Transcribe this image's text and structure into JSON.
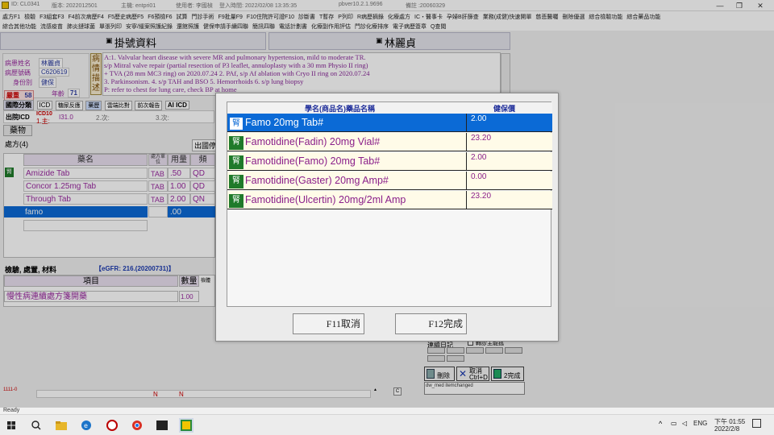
{
  "titlebar": {
    "id": "ID: CL0341",
    "ver": "版本: 2022012501",
    "host": "主機: entpri01",
    "user": "使用者: 李國楨",
    "login": "登入時間: 2022/02/08 13:35:35",
    "server": "pbver10.2.1.9696",
    "note": "備註 :20060329",
    "min": "—",
    "max": "❐",
    "close": "✕"
  },
  "menu1": [
    "處方F1",
    "檢驗",
    "F3組套F3",
    "F4前次病歷F4",
    "F5歷史病歷F5",
    "F6預檢F6",
    "試算",
    "門診手術",
    "F9批量F9",
    "F10住院許可證F10",
    "診斷書",
    "T暫存",
    "P列印",
    "R病歷摘錄",
    "化療處方",
    "IC・醫事卡",
    "孕婦B肝篩查",
    "業務(成健)快速開單",
    "慈悲醫囑",
    "刪除優選",
    "綜合檢驗功能",
    "綜合藥品功能"
  ],
  "menu2": [
    "綜合其他功能",
    "流感疫苗",
    "肺炎鏈球菌",
    "單張列印",
    "安寧/緩案照護紀錄",
    "還館照護",
    "健保申請手續四聯",
    "簡訊四聯",
    "電話計劃書",
    "化療副作用評估",
    "門診化療排序",
    "電子病歷簽章",
    "Q查閱"
  ],
  "header": {
    "reg_title": "掛號資料",
    "patient_name": "林麗貞"
  },
  "patient": {
    "name_label": "病患姓名",
    "name": "林麗貞",
    "chart_label": "病歷號碼",
    "chart": "C620619",
    "id_label": "身份別",
    "id": "健保",
    "severe": "嚴重",
    "severe_val": "58",
    "age_label": "年齡",
    "age": "71"
  },
  "desc": {
    "button": "病情描述",
    "lines": [
      "A:1. Valvular heart disease with severe MR and pulmonary hypertension, mild to moderate TR.",
      "s/p Mitral valve repair (partial resection of P3 leaflet, annuloplasty with a 30 mm Physio II ring)",
      "+ TVA (28 mm MC3 ring) on 2020.07.24  2. PAf, s/p Af ablation with Cryo II ring on 2020.07.24",
      "3. Parkinsonism.  4. s/p TAH and BSO   5. Hemorrhoids  6. s/p lung biopsy",
      "P: refer to chest for lung care, check BP at home"
    ]
  },
  "classrow": [
    "國際分類",
    "ICD",
    "糖尿反應",
    "藥歷",
    "雲端比對",
    "前次報告",
    "AI ICD"
  ],
  "icd": {
    "out_label": "出院ICD",
    "icd10": "ICD10",
    "main": "1.主:",
    "main_code": "I31.0",
    "second": "2.次:",
    "third": "3.次:"
  },
  "tab_drug": "藥物",
  "rx": {
    "title": "處方(4)",
    "right_label": "出國停",
    "headers": [
      "藥名",
      "處方單位",
      "用量",
      "頻"
    ],
    "rows": [
      {
        "icon": "腎",
        "name": "Amizide Tab",
        "unit": "TAB",
        "qty": ".50",
        "freq": "QD"
      },
      {
        "icon": "",
        "name": "Concor 1.25mg Tab",
        "unit": "TAB",
        "qty": "1.00",
        "freq": "QD"
      },
      {
        "icon": "",
        "name": "Through Tab",
        "unit": "TAB",
        "qty": "2.00",
        "freq": "QN"
      },
      {
        "icon": "",
        "name": "famo",
        "unit": "",
        "qty": ".00",
        "freq": ""
      }
    ]
  },
  "exam": {
    "title": "檢驗, 處置, 材料",
    "egfr": "【eGFR: 216.(20200731)】",
    "head_item": "項目",
    "head_qty": "數量",
    "head_extra": "檢體",
    "row_item": "慢性病連續處方箋開藥",
    "row_qty": "1.00"
  },
  "rightpanel": {
    "label": "連續日記",
    "check_label": "轉診主能孤",
    "delete": "刪除",
    "cancel": "取消 Ctrl+D",
    "done": "2完成",
    "dw": "dw_med  itemchanged"
  },
  "bottom": {
    "left_code": "1111-0",
    "n1": "N",
    "n2": "N",
    "arrow": "▲",
    "c": "C"
  },
  "status": "Ready",
  "modal": {
    "head_name": "學名(商品名)藥品名稱",
    "head_price": "健保價",
    "rows": [
      {
        "icon": "腎",
        "name": "Famo 20mg Tab#",
        "price": "2.00"
      },
      {
        "icon": "腎",
        "name": "Famotidine(Fadin) 20mg Vial#",
        "price": "23.20"
      },
      {
        "icon": "腎",
        "name": "Famotidine(Famo) 20mg Tab#",
        "price": "2.00"
      },
      {
        "icon": "腎",
        "name": "Famotidine(Gaster) 20mg Amp#",
        "price": "0.00"
      },
      {
        "icon": "腎",
        "name": "Famotidine(Ulcertin) 20mg/2ml Amp",
        "price": "23.20"
      }
    ],
    "selected_index": 0,
    "cancel_label": "F11取消",
    "done_label": "F12完成"
  },
  "taskbar": {
    "ime": "ENG",
    "time": "下午 01:55",
    "date": "2022/2/8"
  },
  "colors": {
    "selection": "#0b6ad6",
    "kidney_icon": "#1f7a2a",
    "drug_text": "#8a1f8a"
  }
}
